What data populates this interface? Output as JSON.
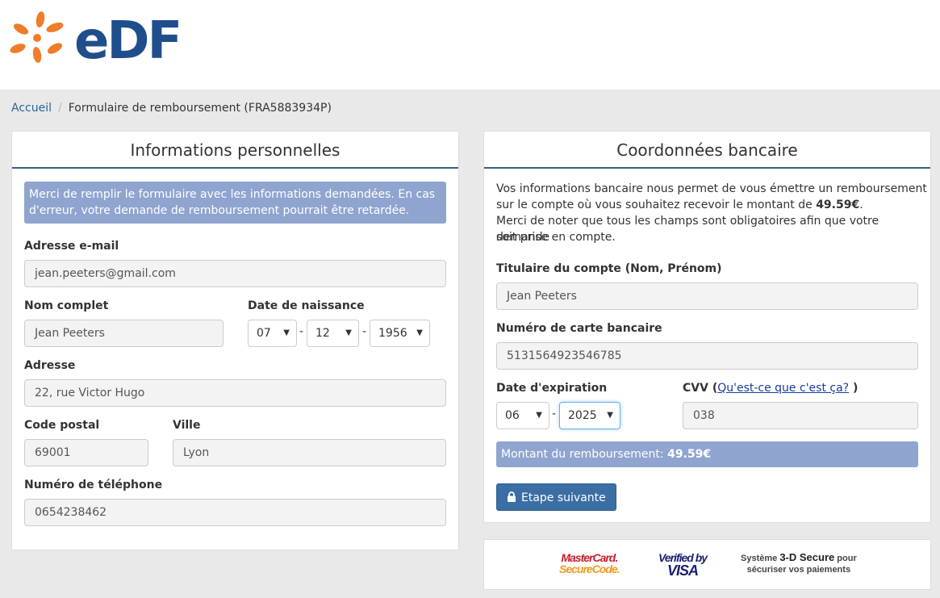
{
  "header": {
    "logo_text": "eDF"
  },
  "breadcrumb": {
    "home": "Accueil",
    "separator": "/",
    "current": "Formulaire de remboursement (FRA5883934P)"
  },
  "personal": {
    "title": "Informations personnelles",
    "notice": "Merci de remplir le formulaire avec les informations demandées. En cas d'erreur, votre demande de remboursement pourrait être retardée.",
    "email_label": "Adresse e-mail",
    "email_value": "jean.peeters@gmail.com",
    "name_label": "Nom complet",
    "name_value": "Jean Peeters",
    "dob_label": "Date de naissance",
    "dob_day": "07",
    "dob_month": "12",
    "dob_year": "1956",
    "address_label": "Adresse",
    "address_value": "22, rue Victor Hugo",
    "postal_label": "Code postal",
    "postal_value": "69001",
    "city_label": "Ville",
    "city_value": "Lyon",
    "phone_label": "Numéro de téléphone",
    "phone_value": "0654238462"
  },
  "bank": {
    "title": "Coordonnées bancaire",
    "intro_1": "Vos informations bancaire nous permet de vous émettre un remboursement",
    "intro_2a": "sur le compte où vous souhaitez recevoir le montant de ",
    "intro_amount": "49.59€",
    "intro_2b": ".",
    "intro_3": "Merci de noter que tous les champs sont obligatoires afin que votre demande",
    "intro_4": "soit prise en compte.",
    "holder_label": "Titulaire du compte (Nom, Prénom)",
    "holder_value": "Jean Peeters",
    "card_label": "Numéro de carte bancaire",
    "card_value": "5131564923546785",
    "expiry_label": "Date d'expiration",
    "expiry_month": "06",
    "expiry_year": "2025",
    "cvv_label": "CVV (",
    "cvv_help": "Qu'est-ce que c'est ça?",
    "cvv_close": " )",
    "cvv_value": "038",
    "amount_label": "Montant du remboursement: ",
    "amount_value": "49.59€",
    "next_button": "Etape suivante"
  },
  "secure": {
    "mastercard_1": "MasterCard.",
    "mastercard_2": "SecureCode.",
    "visa_1": "Verified by",
    "visa_2": "VISA",
    "system_1a": "Système ",
    "system_1b": "3-D Secure",
    "system_1c": " pour",
    "system_2": "sécuriser vos paiements"
  },
  "colors": {
    "brand_blue": "#1f4e8c",
    "brand_orange": "#f07c2a",
    "notice_bg": "#8fa4cf",
    "button_bg": "#3b6ea5"
  }
}
